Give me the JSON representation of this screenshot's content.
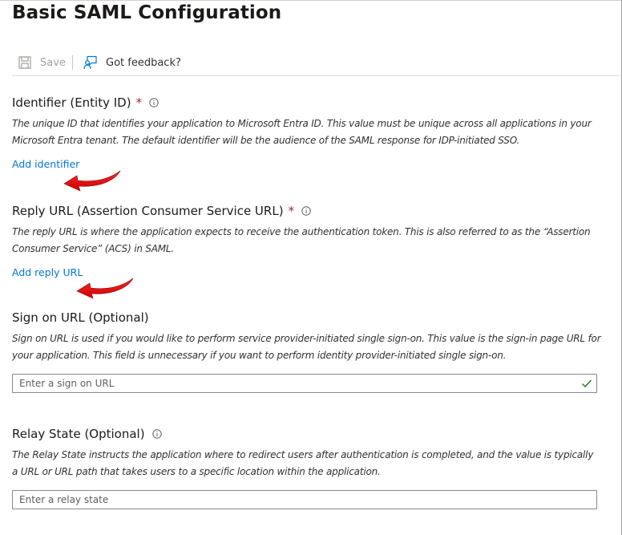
{
  "page": {
    "title": "Basic SAML Configuration"
  },
  "toolbar": {
    "save_label": "Save",
    "feedback_label": "Got feedback?"
  },
  "identifier": {
    "title": "Identifier (Entity ID)",
    "required_mark": "*",
    "description": "The unique ID that identifies your application to Microsoft Entra ID. This value must be unique across all applications in your Microsoft Entra tenant. The default identifier will be the audience of the SAML response for IDP-initiated SSO.",
    "link": "Add identifier"
  },
  "reply_url": {
    "title": "Reply URL (Assertion Consumer Service URL)",
    "required_mark": "*",
    "description": "The reply URL is where the application expects to receive the authentication token. This is also referred to as the “Assertion Consumer Service” (ACS) in SAML.",
    "link": "Add reply URL"
  },
  "sign_on_url": {
    "title": "Sign on URL (Optional)",
    "description": "Sign on URL is used if you would like to perform service provider-initiated single sign-on. This value is the sign-in page URL for your application. This field is unnecessary if you want to perform identity provider-initiated single sign-on.",
    "placeholder": "Enter a sign on URL",
    "value": ""
  },
  "relay_state": {
    "title": "Relay State (Optional)",
    "description": "The Relay State instructs the application where to redirect users after authentication is completed, and the value is typically a URL or URL path that takes users to a specific location within the application.",
    "placeholder": "Enter a relay state",
    "value": ""
  },
  "colors": {
    "link": "#0078d4",
    "required": "#a4262c",
    "annotation_arrow": "#e00000",
    "valid_check": "#107c10"
  },
  "icons": {
    "save": "save-icon",
    "feedback": "feedback-icon",
    "info": "info-icon",
    "valid": "checkmark-icon"
  }
}
